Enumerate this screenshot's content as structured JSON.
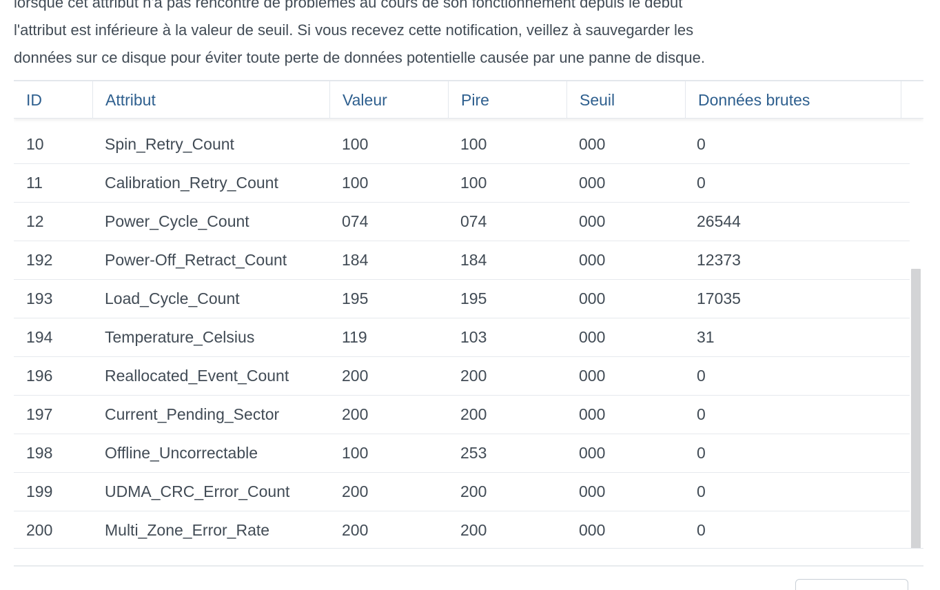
{
  "description": {
    "line1": "lorsque cet attribut n'a pas rencontré de problèmes au cours de son fonctionnement depuis le début",
    "line2": "l'attribut est inférieure à la valeur de seuil. Si vous recevez cette notification, veillez à sauvegarder les",
    "line3": "données sur ce disque pour éviter toute perte de données potentielle causée par une panne de disque."
  },
  "table": {
    "columns": [
      "ID",
      "Attribut",
      "Valeur",
      "Pire",
      "Seuil",
      "Données brutes"
    ],
    "rows": [
      [
        "10",
        "Spin_Retry_Count",
        "100",
        "100",
        "000",
        "0"
      ],
      [
        "11",
        "Calibration_Retry_Count",
        "100",
        "100",
        "000",
        "0"
      ],
      [
        "12",
        "Power_Cycle_Count",
        "074",
        "074",
        "000",
        "26544"
      ],
      [
        "192",
        "Power-Off_Retract_Count",
        "184",
        "184",
        "000",
        "12373"
      ],
      [
        "193",
        "Load_Cycle_Count",
        "195",
        "195",
        "000",
        "17035"
      ],
      [
        "194",
        "Temperature_Celsius",
        "119",
        "103",
        "000",
        "31"
      ],
      [
        "196",
        "Reallocated_Event_Count",
        "200",
        "200",
        "000",
        "0"
      ],
      [
        "197",
        "Current_Pending_Sector",
        "200",
        "200",
        "000",
        "0"
      ],
      [
        "198",
        "Offline_Uncorrectable",
        "100",
        "253",
        "000",
        "0"
      ],
      [
        "199",
        "UDMA_CRC_Error_Count",
        "200",
        "200",
        "000",
        "0"
      ],
      [
        "200",
        "Multi_Zone_Error_Rate",
        "200",
        "200",
        "000",
        "0"
      ]
    ]
  },
  "footer": {
    "button_label": ""
  },
  "colors": {
    "header_text": "#2e5f8e",
    "body_text": "#414b55",
    "divider": "#e3e7ec",
    "scrollbar": "#d3d4d6"
  }
}
